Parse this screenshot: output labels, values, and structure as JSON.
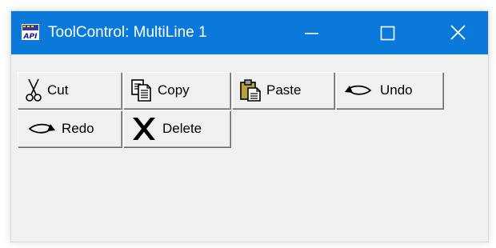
{
  "window": {
    "title": "ToolControl: MultiLine 1",
    "app_icon": "api-app-icon",
    "title_color": "#0b79d9",
    "controls": {
      "minimize_icon": "minimize-icon",
      "maximize_icon": "maximize-icon",
      "close_icon": "close-icon"
    }
  },
  "toolbar": {
    "rows": [
      [
        {
          "label": "Cut",
          "icon": "scissors-icon"
        },
        {
          "label": "Copy",
          "icon": "copy-icon"
        },
        {
          "label": "Paste",
          "icon": "paste-icon"
        },
        {
          "label": "Undo",
          "icon": "undo-icon"
        }
      ],
      [
        {
          "label": "Redo",
          "icon": "redo-icon"
        },
        {
          "label": "Delete",
          "icon": "delete-x-icon"
        }
      ]
    ]
  },
  "app_icon_text": "API"
}
